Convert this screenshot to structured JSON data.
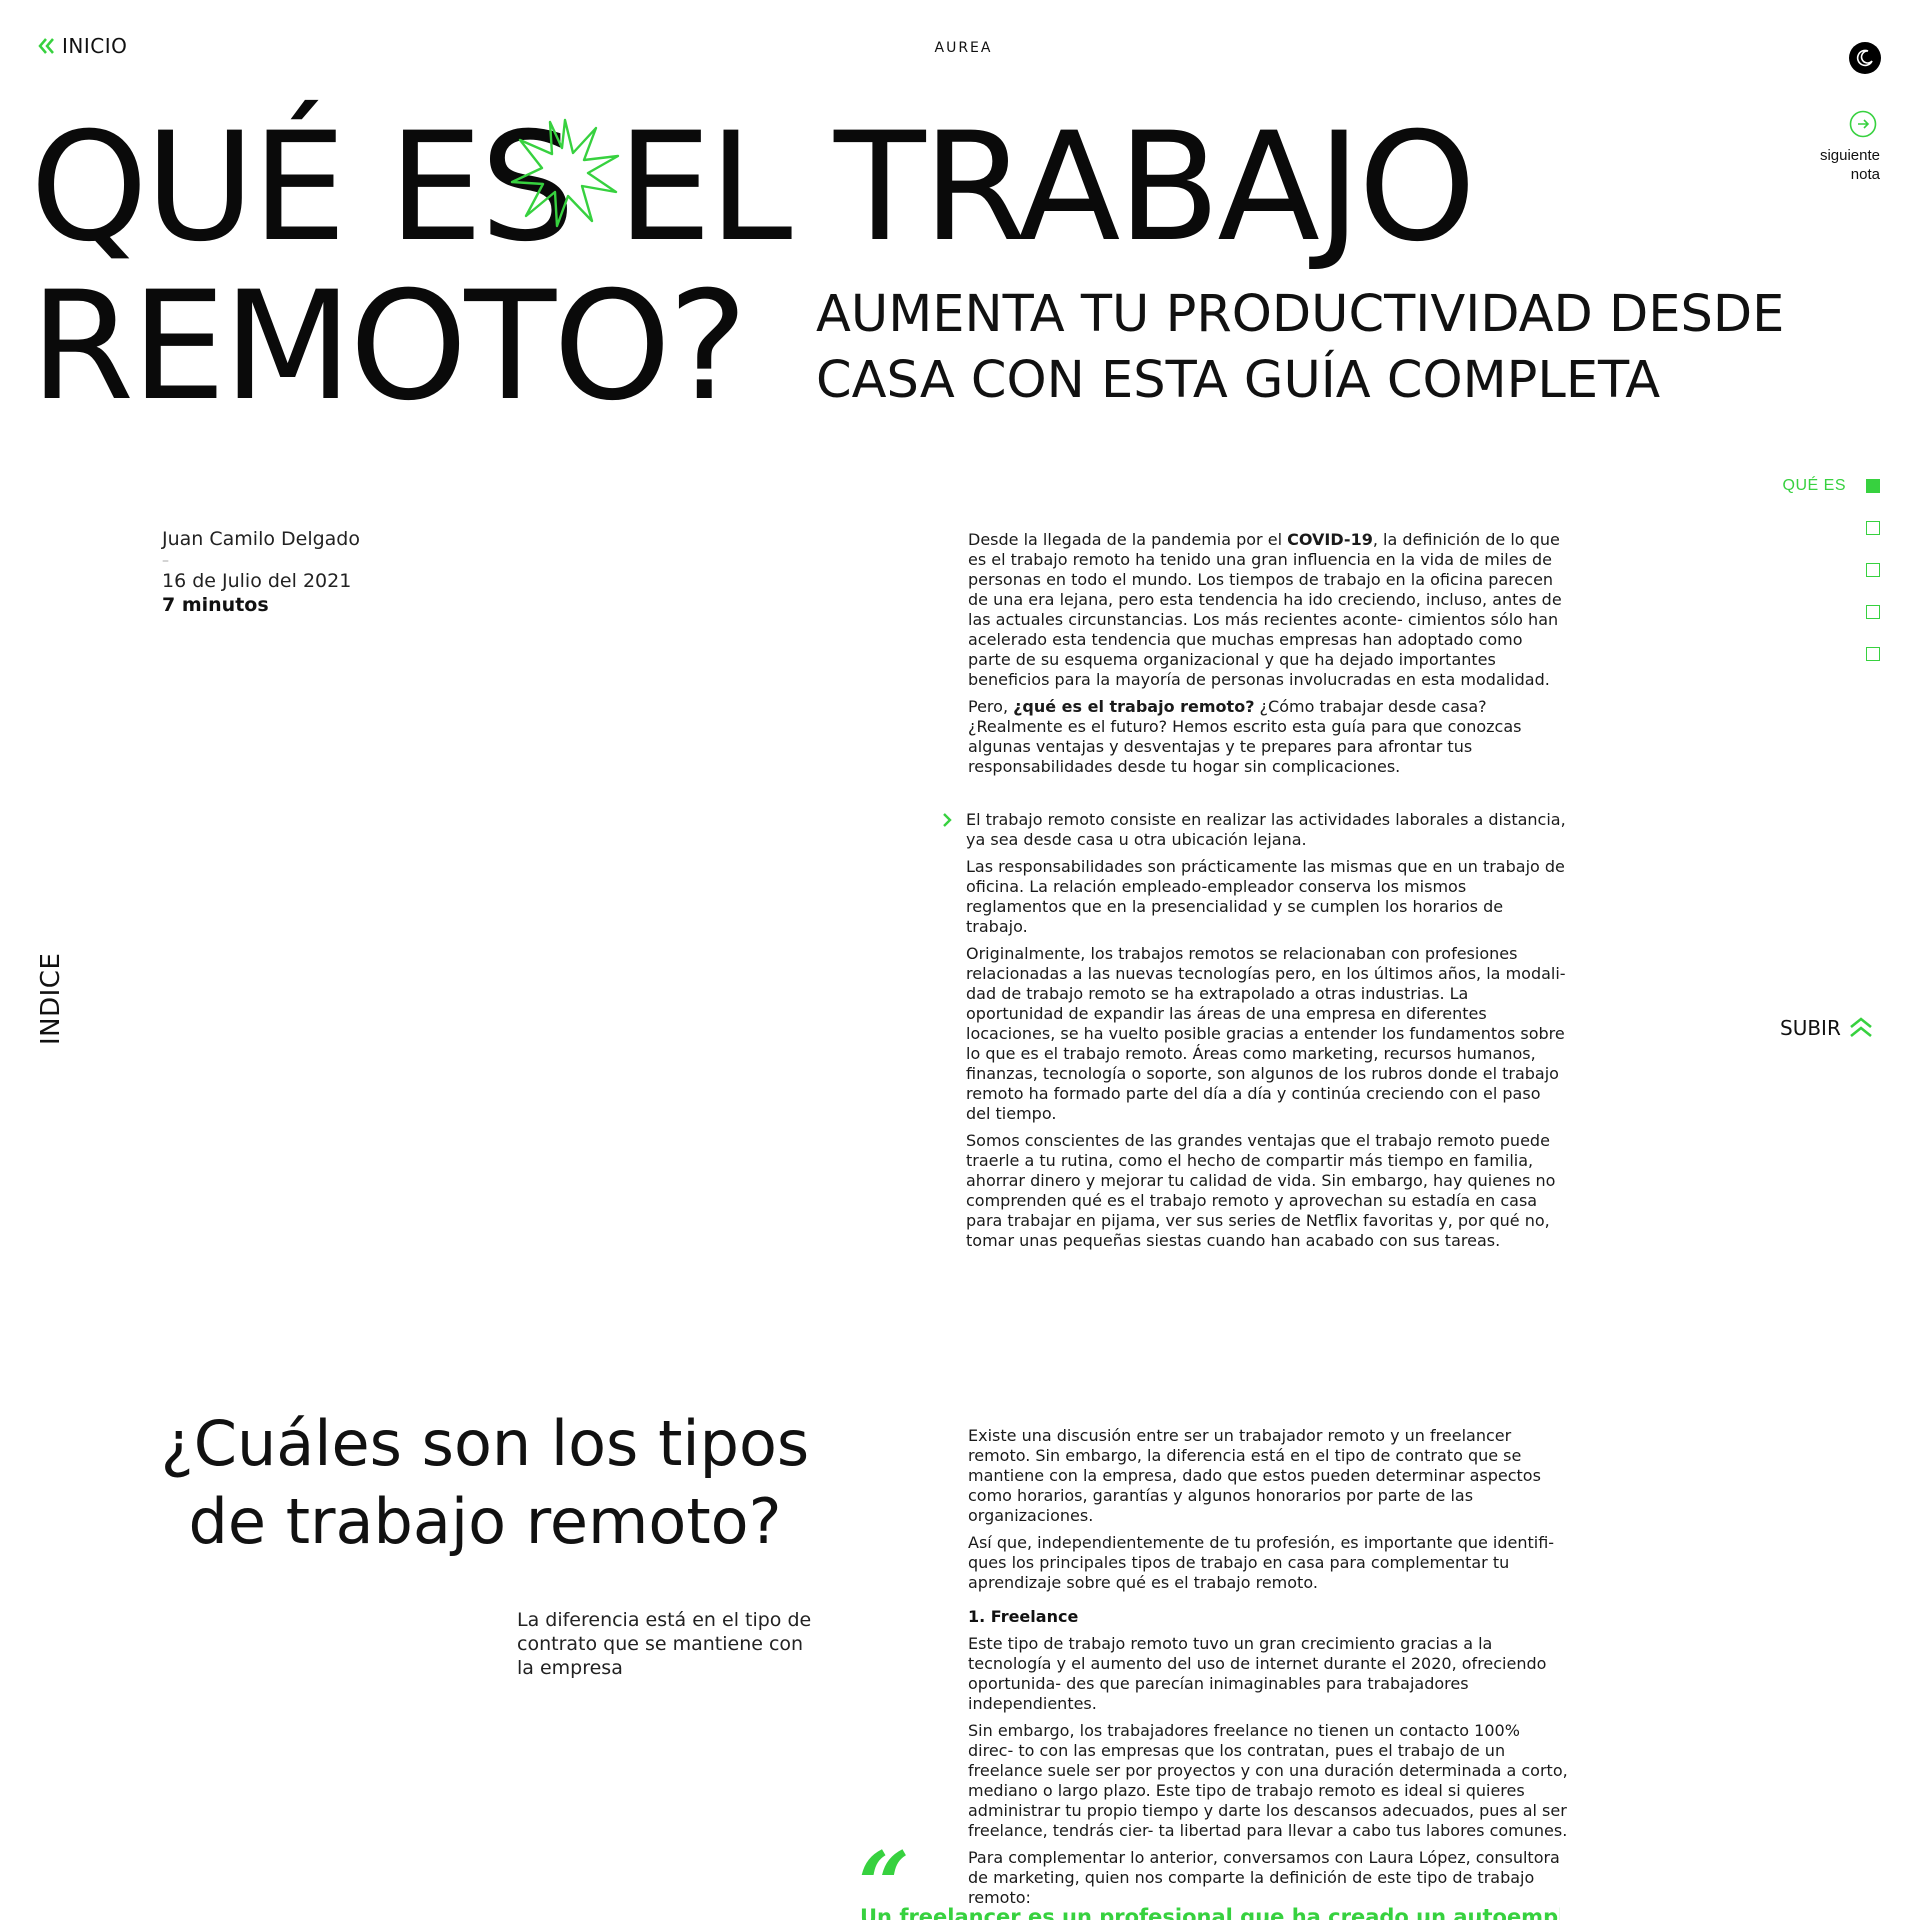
{
  "accent_color": "#37d13f",
  "nav": {
    "back_label": "INICIO",
    "back_icon": "double-chevron-left-icon",
    "brand": "AUREA",
    "theme_icon": "moon-icon"
  },
  "next_note": {
    "line1": "siguiente",
    "line2": "nota",
    "icon": "arrow-right-circle-icon"
  },
  "hero": {
    "line1_a": "QUÉ ES",
    "line1_b": "EL TRABAJO",
    "line2": "REMOTO?",
    "subtitle_line1": "AUMENTA TU PRODUCTIVIDAD DESDE",
    "subtitle_line2": "CASA CON ESTA GUÍA COMPLETA",
    "decoration_icon": "star-burst-icon"
  },
  "index": {
    "items": [
      {
        "label": "QUÉ ES",
        "active": true
      },
      {
        "label": "",
        "active": false
      },
      {
        "label": "",
        "active": false
      },
      {
        "label": "",
        "active": false
      },
      {
        "label": "",
        "active": false
      }
    ],
    "vertical_label": "INDICE",
    "up_label": "SUBIR",
    "up_icon": "double-chevron-up-icon"
  },
  "meta": {
    "author": "Juan Camilo Delgado",
    "dash": "–",
    "date": "16 de Julio del 2021",
    "read_time": "7 minutos"
  },
  "article": {
    "intro_1_pre": "Desde la llegada de la pandemia por el ",
    "intro_1_bold": "COVID-19",
    "intro_1_post": ", la definición de lo que es el trabajo remoto ha tenido una gran influencia en la vida de miles de personas en todo el mundo. Los tiempos de trabajo en la oficina parecen de una era lejana, pero esta tendencia ha ido creciendo, incluso, antes de las actuales circunstancias.  Los más recientes aconte- cimientos sólo han acelerado esta tendencia que muchas empresas han adoptado como parte de su esquema organizacional y que ha dejado importantes beneficios para la mayoría de personas involucradas en esta modalidad.",
    "intro_2_pre": "Pero, ",
    "intro_2_bold": "¿qué es el trabajo remoto?",
    "intro_2_post": " ¿Cómo trabajar desde casa? ¿Realmente es el futuro? Hemos escrito esta guía para que conozcas algunas ventajas y desventajas y te prepares para afrontar tus responsabilidades desde tu hogar sin complicaciones.",
    "def_1": "El trabajo remoto consiste en realizar las actividades laborales a distancia, ya sea desde casa u otra ubicación lejana.",
    "def_2": "Las responsabilidades son prácticamente las mismas que en un trabajo de oficina. La relación empleado-empleador conserva los mismos reglamentos que en la presencialidad y se cumplen los horarios de trabajo.",
    "def_3": "Originalmente, los trabajos remotos se relacionaban con profesiones relacionadas a las nuevas tecnologías pero, en los últimos años, la modali- dad de trabajo remoto se ha extrapolado a otras industrias. La oportunidad de expandir las áreas de una empresa en diferentes locaciones, se ha vuelto posible gracias a entender los fundamentos sobre lo que es el trabajo remoto. Áreas como marketing, recursos humanos, finanzas, tecnología o soporte, son algunos de los rubros donde el trabajo remoto ha formado parte del día a día y continúa creciendo con el paso del tiempo.",
    "def_4": "Somos conscientes de las grandes ventajas que el trabajo remoto puede traerle a tu rutina, como el hecho de compartir más tiempo en familia, ahorrar dinero y mejorar tu calidad de vida. Sin embargo, hay quienes no comprenden qué es el trabajo remoto y aprovechan su estadía en casa para trabajar en pijama, ver sus series de Netflix favoritas y, por qué no, tomar unas pequeñas siestas cuando han acabado con sus tareas.",
    "types_heading": "¿Cuáles son los tipos de trabajo remoto?",
    "types_pull": "La diferencia está en el tipo de contrato que se mantiene con la empresa",
    "types_1": "Existe una discusión entre ser un trabajador remoto y un freelancer remoto. Sin embargo, la diferencia está en el tipo de contrato que se mantiene con la empresa, dado que estos pueden determinar aspectos como horarios, garantías y algunos honorarios por parte de las organizaciones.",
    "types_2": "Así que, independientemente de tu profesión, es importante que identifi- ques los principales tipos de trabajo en casa para complementar tu aprendizaje sobre qué es el trabajo remoto.",
    "freelance_title": "1. Freelance",
    "freelance_1": "Este tipo de trabajo remoto tuvo un gran crecimiento gracias a la tecnología y el aumento del uso de internet durante el 2020, ofreciendo oportunida- des que parecían inimaginables para trabajadores independientes.",
    "freelance_2": "Sin embargo, los trabajadores freelance no tienen un contacto 100% direc- to con las empresas que los contratan, pues el trabajo de un freelance suele ser  por proyectos y con una duración determinada a corto, mediano o largo plazo. Este tipo de trabajo remoto es ideal si quieres administrar tu propio tiempo y darte los descansos adecuados, pues al ser freelance, tendrás cier- ta libertad  para llevar a cabo tus labores comunes.",
    "freelance_3": "Para complementar lo anterior, conversamos con Laura López, consultora de marketing, quien nos comparte la definición de este tipo de trabajo remoto:",
    "quote_mark": "“",
    "quote_text": "Un freelancer es un profesional que ha creado un autoempleo para"
  }
}
